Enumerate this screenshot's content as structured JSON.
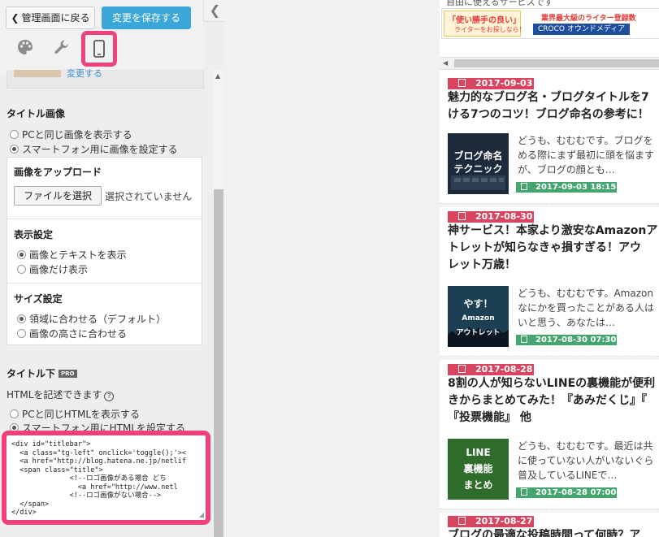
{
  "header": {
    "back_label": "管理画面に戻る",
    "back_chevron": "❮",
    "save_label": "変更を保存する",
    "collapse_glyph": "❮"
  },
  "tabs": [
    {
      "icon": "palette-icon"
    },
    {
      "icon": "wrench-icon"
    },
    {
      "icon": "smartphone-icon",
      "selected": true
    }
  ],
  "profile": {
    "change_link": "変更する"
  },
  "title_image": {
    "heading": "タイトル画像",
    "options": [
      {
        "label": "PCと同じ画像を表示する",
        "checked": false
      },
      {
        "label": "スマートフォン用に画像を設定する",
        "checked": true
      }
    ],
    "upload": {
      "heading": "画像をアップロード",
      "file_button": "ファイルを選択",
      "file_status": "選択されていません"
    },
    "display": {
      "heading": "表示設定",
      "options": [
        {
          "label": "画像とテキストを表示",
          "checked": true
        },
        {
          "label": "画像だけ表示",
          "checked": false
        }
      ]
    },
    "size": {
      "heading": "サイズ設定",
      "options": [
        {
          "label": "領域に合わせる（デフォルト）",
          "checked": true
        },
        {
          "label": "画像の高さに合わせる",
          "checked": false
        }
      ]
    }
  },
  "title_below": {
    "heading": "タイトル下",
    "badge": "PRO",
    "html_hint": "HTMLを記述できます",
    "help_glyph": "?",
    "options": [
      {
        "label": "PCと同じHTMLを表示する",
        "checked": false
      },
      {
        "label": "スマートフォン用にHTMLを設定する",
        "checked": true
      }
    ],
    "code": "<div id=\"titlebar\">\n  <a class=\"tg-left\" onclick='toggle();'><\n  <a href=\"http://blog.hatena.ne.jp/netlif\n  <span class=\"title\">\n              <!--ロゴ画像がある場合 どち\n                <a href=\"http://www.netl\n              <!--ロゴ画像がない場合-->\n  </span>\n</div>"
  },
  "preview": {
    "top_clipped_text": "自由に使えるサービスです",
    "banner": {
      "left_line1": "「使い勝手の良い」",
      "left_line2": "ライターをお探しなら！",
      "right_line1": "業界最大級のライター登録数",
      "right_line2": "CROCO オウンドメディア"
    },
    "articles": [
      {
        "date": "2017-09-03",
        "title_lines": [
          "魅力的なブログ名・ブログタイトルを7",
          "ける7つのコツ！ブログ命名の参考に！"
        ],
        "thumb_text": [
          "ブログ命名",
          "テクニック"
        ],
        "excerpt_lines": [
          "どうも、むむむです。ブログを",
          "める際にまず最初に頭を悩ます",
          "が、ブログの顔とも…"
        ],
        "datetime": "2017-09-03 18:15"
      },
      {
        "date": "2017-08-30",
        "title_lines": [
          "神サービス！本家より激安なAmazonア",
          "トレットが知らなきゃ損すぎる！アウ",
          "レット万歳！"
        ],
        "thumb_text": [
          "やす！",
          "Amazon",
          "アウトレット"
        ],
        "excerpt_lines": [
          "どうも、むむむです。Amazon",
          "なにかを買ったことがある人は",
          "いと思う、あなたは…"
        ],
        "datetime": "2017-08-30 07:30"
      },
      {
        "date": "2017-08-28",
        "title_lines": [
          "8割の人が知らないLINEの裏機能が便利",
          "きからまとめてみた！『あみだくじ』『",
          "『投票機能』 他"
        ],
        "thumb_text": [
          "LINE",
          "裏機能",
          "まとめ"
        ],
        "excerpt_lines": [
          "どうも、むむむです。最近は共",
          "に使っていない人がいないぐら",
          "普及しているLINEで…"
        ],
        "datetime": "2017-08-28 07:00"
      },
      {
        "date": "2017-08-27",
        "title_lines": [
          "ブログの最適な投稿時間って何時？ア"
        ]
      }
    ]
  },
  "colors": {
    "save_button": "#3ba6d8",
    "highlight": "#f0417a",
    "date_badge": "#d9455f",
    "datetime_badge": "#45a56e"
  }
}
